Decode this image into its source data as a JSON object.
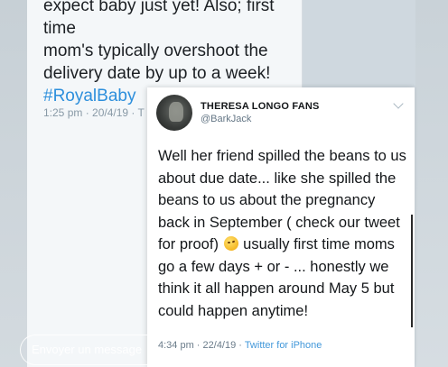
{
  "tweet_back": {
    "text_lines": [
      "expect baby just yet! Also; first time",
      "mom's typically overshoot the",
      "delivery date by up to a week!"
    ],
    "hashtag": "#RoyalBaby",
    "timestamp": "1:25 pm · 20/4/19 · T"
  },
  "tweet_front": {
    "display_name": "THERESA LONGO FANS",
    "handle": "@BarkJack",
    "text_before_emoji": "Well her friend spilled the beans to us about due date... like she spilled the beans to us about the pregnancy back in September ( check our tweet for proof)",
    "text_after_emoji": "usually first time moms go a few days + or - ... honestly we think it all happen around May 5 but could happen anytime!",
    "timestamp": "4:34 pm · 22/4/19 · ",
    "source": "Twitter for iPhone"
  },
  "message_bar": {
    "placeholder": "Envoyer un message"
  },
  "icons": {
    "emoji": "winking-face-emoji",
    "send": "paper-plane-icon",
    "menu": "chevron-down-icon"
  }
}
